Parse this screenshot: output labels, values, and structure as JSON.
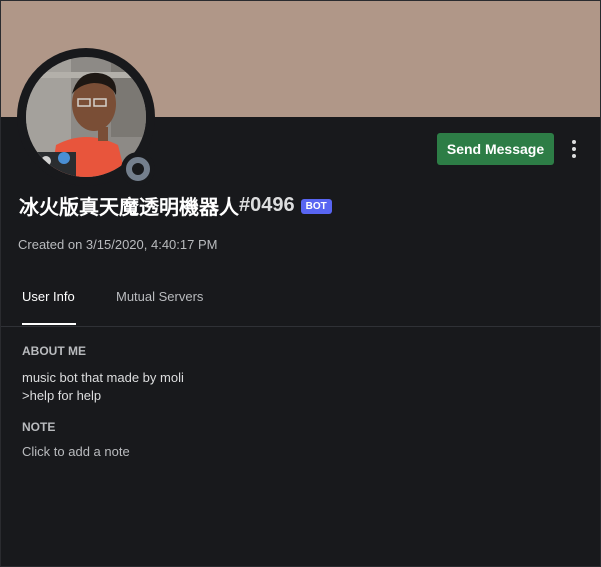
{
  "colors": {
    "banner": "#b09788",
    "background": "#18191c",
    "send_button": "#2d7d46",
    "bot_tag": "#5865f2",
    "status_offline": "#747f8d"
  },
  "header": {
    "send_message_label": "Send Message",
    "more_icon": "vertical-ellipsis-icon"
  },
  "avatar": {
    "status": "offline"
  },
  "user": {
    "username": "冰火版真天魔透明機器人",
    "discriminator": "#0496",
    "bot_tag": "BOT",
    "created": "Created on 3/15/2020, 4:40:17 PM"
  },
  "tabs": [
    {
      "label": "User Info",
      "active": true
    },
    {
      "label": "Mutual Servers",
      "active": false
    }
  ],
  "about": {
    "title": "ABOUT ME",
    "lines": [
      "music bot that made by moli",
      ">help for help"
    ]
  },
  "note": {
    "title": "NOTE",
    "placeholder": "Click to add a note"
  }
}
